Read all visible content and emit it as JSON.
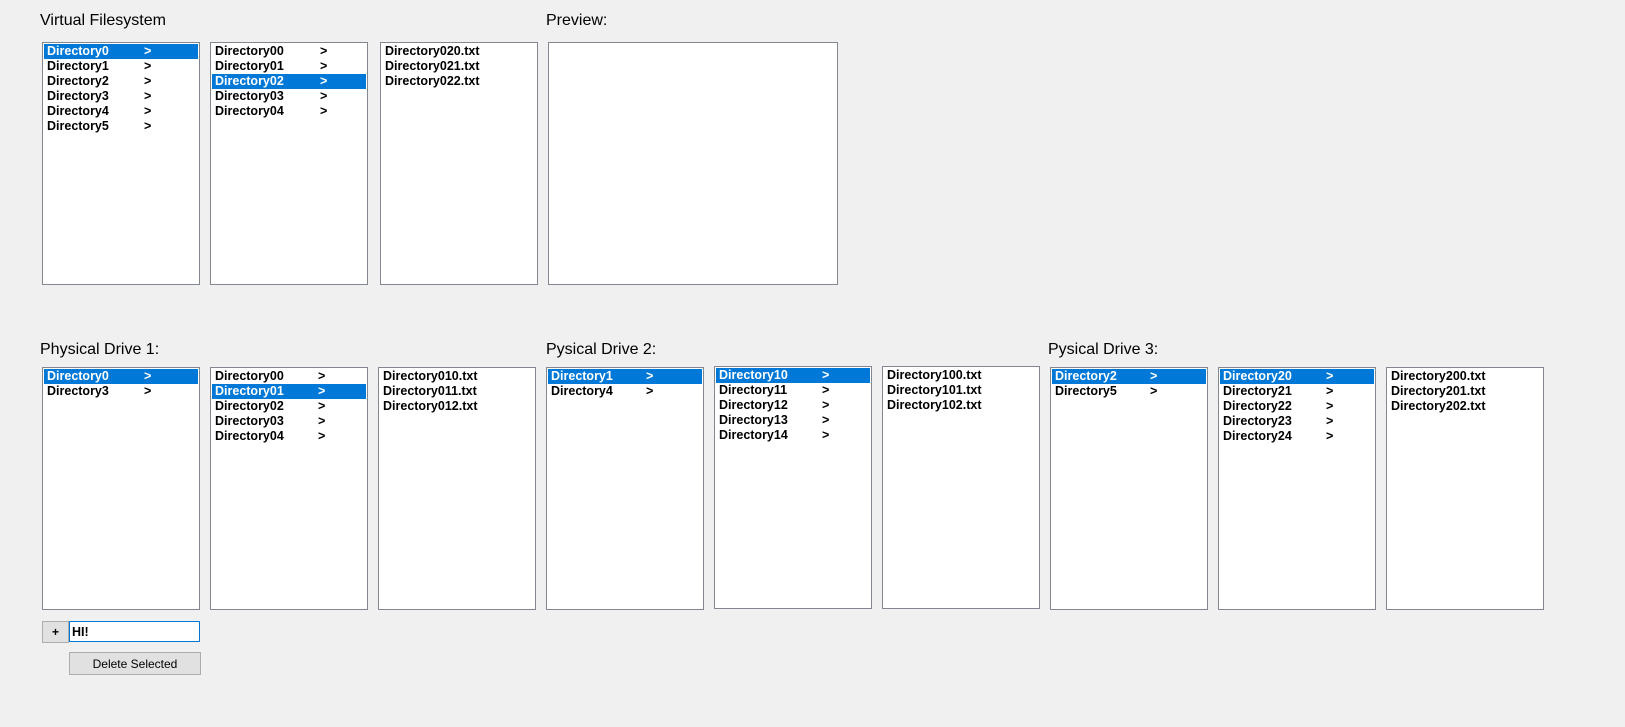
{
  "labels": {
    "virtual_filesystem": "Virtual Filesystem",
    "preview": "Preview:",
    "physical_drive_1": "Physical Drive 1:",
    "physical_drive_2": "Pysical Drive 2:",
    "physical_drive_3": "Pysical Drive 3:"
  },
  "virtual": {
    "col1": [
      {
        "name": "Directory0",
        "arrow": ">",
        "selected": true
      },
      {
        "name": "Directory1",
        "arrow": ">",
        "selected": false
      },
      {
        "name": "Directory2",
        "arrow": ">",
        "selected": false
      },
      {
        "name": "Directory3",
        "arrow": ">",
        "selected": false
      },
      {
        "name": "Directory4",
        "arrow": ">",
        "selected": false
      },
      {
        "name": "Directory5",
        "arrow": ">",
        "selected": false
      }
    ],
    "col2": [
      {
        "name": "Directory00",
        "arrow": ">",
        "selected": false
      },
      {
        "name": "Directory01",
        "arrow": ">",
        "selected": false
      },
      {
        "name": "Directory02",
        "arrow": ">",
        "selected": true
      },
      {
        "name": "Directory03",
        "arrow": ">",
        "selected": false
      },
      {
        "name": "Directory04",
        "arrow": ">",
        "selected": false
      }
    ],
    "col3": [
      {
        "name": "Directory020.txt",
        "arrow": "",
        "selected": false
      },
      {
        "name": "Directory021.txt",
        "arrow": "",
        "selected": false
      },
      {
        "name": "Directory022.txt",
        "arrow": "",
        "selected": false
      }
    ]
  },
  "drive1": {
    "col1": [
      {
        "name": "Directory0",
        "arrow": ">",
        "selected": true
      },
      {
        "name": "Directory3",
        "arrow": ">",
        "selected": false
      }
    ],
    "col2": [
      {
        "name": "Directory00",
        "arrow": ">",
        "selected": false
      },
      {
        "name": "Directory01",
        "arrow": ">",
        "selected": true
      },
      {
        "name": "Directory02",
        "arrow": ">",
        "selected": false
      },
      {
        "name": "Directory03",
        "arrow": ">",
        "selected": false
      },
      {
        "name": "Directory04",
        "arrow": ">",
        "selected": false
      }
    ],
    "col3": [
      {
        "name": "Directory010.txt",
        "arrow": "",
        "selected": false
      },
      {
        "name": "Directory011.txt",
        "arrow": "",
        "selected": false
      },
      {
        "name": "Directory012.txt",
        "arrow": "",
        "selected": false
      }
    ]
  },
  "drive2": {
    "col1": [
      {
        "name": "Directory1",
        "arrow": ">",
        "selected": true
      },
      {
        "name": "Directory4",
        "arrow": ">",
        "selected": false
      }
    ],
    "col2": [
      {
        "name": "Directory10",
        "arrow": ">",
        "selected": true
      },
      {
        "name": "Directory11",
        "arrow": ">",
        "selected": false
      },
      {
        "name": "Directory12",
        "arrow": ">",
        "selected": false
      },
      {
        "name": "Directory13",
        "arrow": ">",
        "selected": false
      },
      {
        "name": "Directory14",
        "arrow": ">",
        "selected": false
      }
    ],
    "col3": [
      {
        "name": "Directory100.txt",
        "arrow": "",
        "selected": false
      },
      {
        "name": "Directory101.txt",
        "arrow": "",
        "selected": false
      },
      {
        "name": "Directory102.txt",
        "arrow": "",
        "selected": false
      }
    ]
  },
  "drive3": {
    "col1": [
      {
        "name": "Directory2",
        "arrow": ">",
        "selected": true
      },
      {
        "name": "Directory5",
        "arrow": ">",
        "selected": false
      }
    ],
    "col2": [
      {
        "name": "Directory20",
        "arrow": ">",
        "selected": true
      },
      {
        "name": "Directory21",
        "arrow": ">",
        "selected": false
      },
      {
        "name": "Directory22",
        "arrow": ">",
        "selected": false
      },
      {
        "name": "Directory23",
        "arrow": ">",
        "selected": false
      },
      {
        "name": "Directory24",
        "arrow": ">",
        "selected": false
      }
    ],
    "col3": [
      {
        "name": "Directory200.txt",
        "arrow": "",
        "selected": false
      },
      {
        "name": "Directory201.txt",
        "arrow": "",
        "selected": false
      },
      {
        "name": "Directory202.txt",
        "arrow": "",
        "selected": false
      }
    ]
  },
  "controls": {
    "add_label": "+",
    "input_value": "HI!",
    "delete_label": "Delete Selected"
  },
  "colors": {
    "selection": "#0078d7",
    "background": "#f0f0f0"
  }
}
